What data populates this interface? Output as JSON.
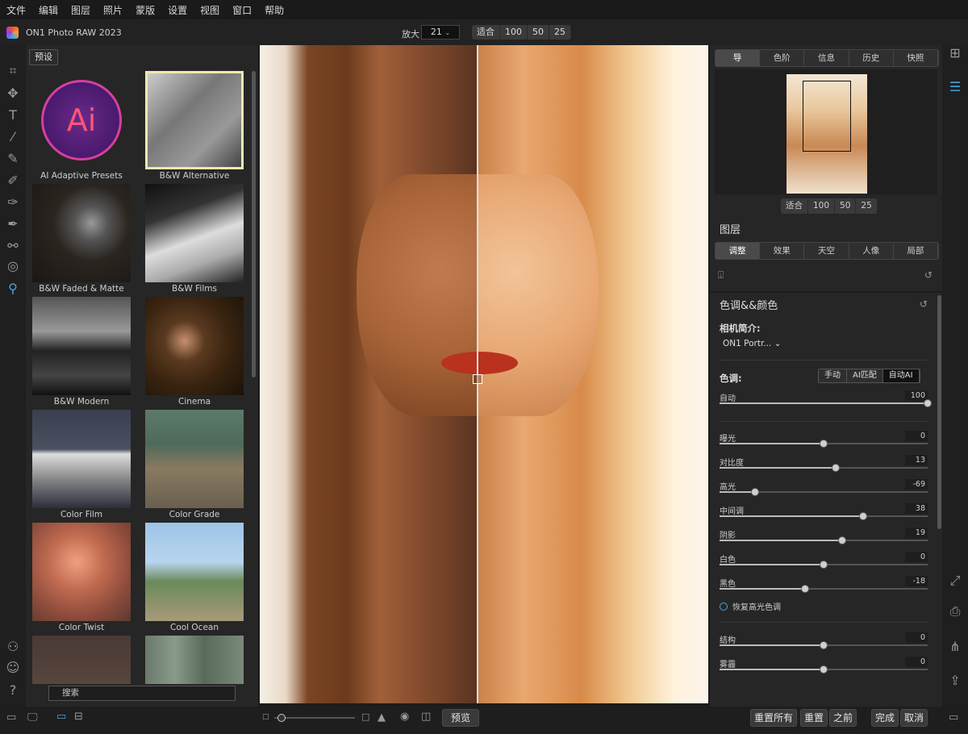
{
  "menu": [
    "文件",
    "编辑",
    "图层",
    "照片",
    "蒙版",
    "设置",
    "视图",
    "窗口",
    "帮助"
  ],
  "app": {
    "title": "ON1 Photo RAW 2023"
  },
  "zoom": {
    "label": "放大",
    "value": "21",
    "buttons": [
      "适合",
      "100",
      "50",
      "25"
    ]
  },
  "left_tools": [
    "crop-icon",
    "move-icon",
    "text-icon",
    "magic-wand-icon",
    "retouch-icon",
    "brush-icon",
    "mask-brush-icon",
    "eyedropper-icon",
    "clone-icon",
    "fingerprint-icon",
    "hand-zoom-icon"
  ],
  "presets": {
    "button": "预设",
    "items": [
      {
        "label": "AI Adaptive Presets"
      },
      {
        "label": "B&W Alternative"
      },
      {
        "label": "B&W Faded & Matte"
      },
      {
        "label": "B&W Films"
      },
      {
        "label": "B&W Modern"
      },
      {
        "label": "Cinema"
      },
      {
        "label": "Color Film"
      },
      {
        "label": "Color Grade"
      },
      {
        "label": "Color Twist"
      },
      {
        "label": "Cool Ocean"
      },
      {
        "label": ""
      },
      {
        "label": ""
      }
    ],
    "search_placeholder": "搜索",
    "ai_badge": "Ai"
  },
  "right_panel": {
    "top_tabs": [
      "导",
      "色阶",
      "信息",
      "历史",
      "快照"
    ],
    "nav_buttons": [
      "适合",
      "100",
      "50",
      "25"
    ],
    "layers_title": "图层",
    "layer_tabs": [
      "调整",
      "效果",
      "天空",
      "人像",
      "局部"
    ],
    "section_title": "色调&&颜色",
    "camera_profile_label": "相机简介:",
    "camera_profile_value": "ON1 Portr...",
    "tone_label": "色调:",
    "tone_modes": [
      "手动",
      "AI匹配",
      "自动AI"
    ],
    "auto": {
      "label": "自动",
      "value": "100",
      "fraction": 1.0
    },
    "sliders": [
      {
        "label": "曝光",
        "value": "0",
        "fraction": 0.5
      },
      {
        "label": "对比度",
        "value": "13",
        "fraction": 0.56
      },
      {
        "label": "高光",
        "value": "-69",
        "fraction": 0.17
      },
      {
        "label": "中间调",
        "value": "38",
        "fraction": 0.69
      },
      {
        "label": "阴影",
        "value": "19",
        "fraction": 0.59
      },
      {
        "label": "白色",
        "value": "0",
        "fraction": 0.5
      },
      {
        "label": "黑色",
        "value": "-18",
        "fraction": 0.41
      }
    ],
    "recover_label": "恢复高光色调",
    "sliders2": [
      {
        "label": "结构",
        "value": "0",
        "fraction": 0.5
      },
      {
        "label": "雾霾",
        "value": "0",
        "fraction": 0.5
      }
    ]
  },
  "bottom": {
    "preview": "预览",
    "reset_all": "重置所有",
    "reset": "重置",
    "before": "之前",
    "done": "完成",
    "cancel": "取消"
  },
  "colors": {
    "accent": "#4aa3df",
    "panel": "#262626",
    "bg": "#1c1c1c"
  }
}
